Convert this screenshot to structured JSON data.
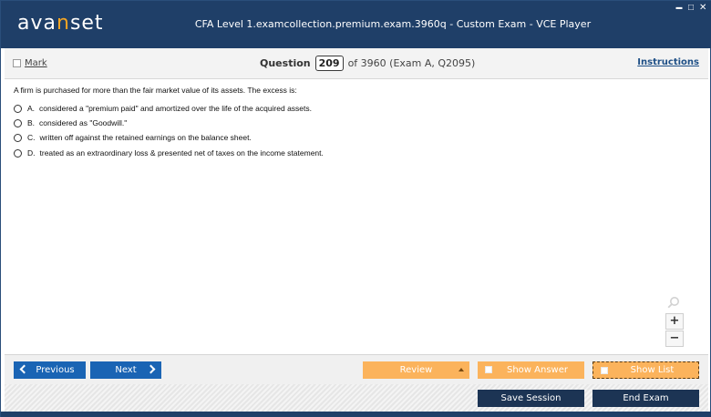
{
  "app": {
    "logo_prefix": "ava",
    "logo_accent": "n",
    "logo_suffix": "set",
    "window_title": "CFA Level 1.examcollection.premium.exam.3960q - Custom Exam - VCE Player",
    "minimize_glyph": "▬",
    "maximize_glyph": "□",
    "close_glyph": "✕"
  },
  "header": {
    "mark_label": "Mark",
    "question_word": "Question",
    "question_number": "209",
    "question_of": "of 3960 (Exam A, Q2095)",
    "instructions_label": "Instructions"
  },
  "question": {
    "stem": "A firm is purchased for more than the fair market value of its assets. The excess is:",
    "options": [
      {
        "letter": "A.",
        "text": "considered a \"premium paid\" and amortized over the life of the acquired assets."
      },
      {
        "letter": "B.",
        "text": "considered as \"Goodwill.\""
      },
      {
        "letter": "C.",
        "text": "written off against the retained earnings on the balance sheet."
      },
      {
        "letter": "D.",
        "text": "treated as an extraordinary loss & presented net of taxes on the income statement."
      }
    ]
  },
  "zoom": {
    "icon": "magnifier-icon",
    "plus": "+",
    "minus": "−"
  },
  "nav": {
    "previous_label": "Previous",
    "next_label": "Next",
    "review_label": "Review",
    "show_answer_label": "Show Answer",
    "show_list_label": "Show List",
    "save_session_label": "Save Session",
    "end_exam_label": "End Exam"
  },
  "colors": {
    "titlebar": "#1f3f68",
    "logo_accent": "#f5a623",
    "nav_blue": "#1a64b4",
    "action_navy": "#1c3454",
    "orange": "#fbb35c",
    "link": "#1e4f86"
  }
}
